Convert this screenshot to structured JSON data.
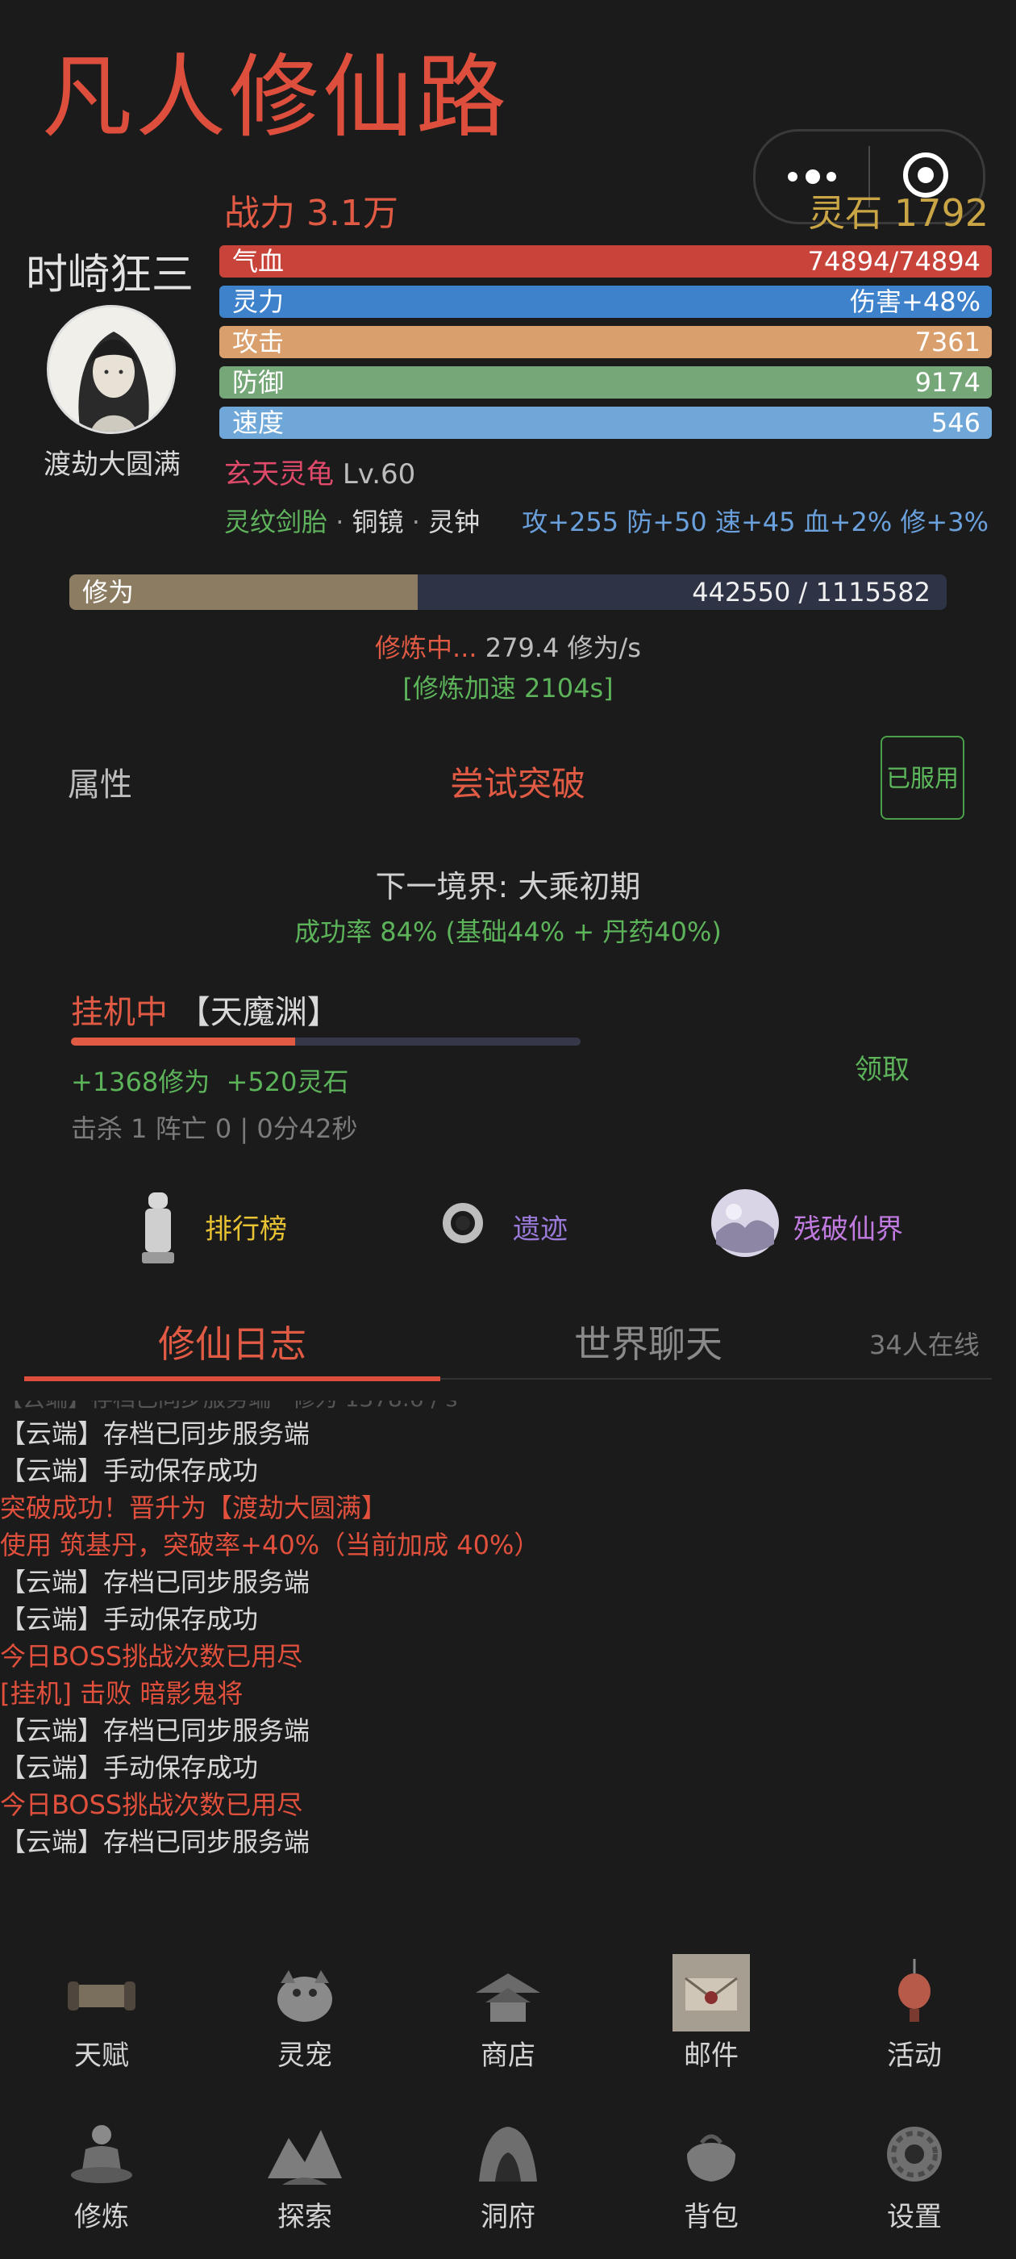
{
  "app": {
    "title": "凡人修仙路"
  },
  "header": {
    "power_label": "战力 3.1万",
    "stones_label": "灵石 1792"
  },
  "player": {
    "name": "时崎狂三",
    "realm": "渡劫大圆满"
  },
  "stats": [
    {
      "label": "气血",
      "value": "74894/74894",
      "color": "#c8443b"
    },
    {
      "label": "灵力",
      "value": "伤害+48%",
      "color": "#3e82cc"
    },
    {
      "label": "攻击",
      "value": "7361",
      "color": "#d9a06e"
    },
    {
      "label": "防御",
      "value": "9174",
      "color": "#76a779"
    },
    {
      "label": "速度",
      "value": "546",
      "color": "#6fa7d8"
    }
  ],
  "pet": {
    "name": "玄天灵龟",
    "level": "Lv.60"
  },
  "equipment": {
    "item1": "灵纹剑胎",
    "sep": "·",
    "item2": "铜镜",
    "item3": "灵钟",
    "bonus": "攻+255 防+50 速+45 血+2% 修+3%"
  },
  "cultivation": {
    "label": "修为",
    "current": 442550,
    "max": 1115582,
    "text": "442550 / 1115582",
    "status_prefix": "修炼中...",
    "status_rate": " 279.4 修为/s",
    "boost": "[修炼加速 2104s]"
  },
  "breakthrough": {
    "attr_label": "属性",
    "button": "尝试突破",
    "used_badge": "已服用",
    "next_realm": "下一境界: 大乘初期",
    "success_rate": "成功率 84% (基础44% + 丹药40%)"
  },
  "idle": {
    "status": "挂机中",
    "location": "【天魔渊】",
    "progress": 0.44,
    "gain_xp": "+1368修为",
    "gain_stones": "+520灵石",
    "claim": "领取",
    "stats": "击杀 1  阵亡 0 | 0分42秒"
  },
  "quick_links": [
    {
      "label": "排行榜",
      "color": "#e7c233",
      "icon": "statue-icon"
    },
    {
      "label": "遗迹",
      "color": "#9a7ad8",
      "icon": "ring-icon"
    },
    {
      "label": "残破仙界",
      "color": "#c07ae0",
      "icon": "cloud-orb-icon"
    }
  ],
  "tabs": {
    "log": "修仙日志",
    "chat": "世界聊天",
    "online": "34人在线"
  },
  "log_entries": [
    {
      "text": "【云端】存档已同步服务端",
      "color": "#d8d8d8"
    },
    {
      "text": "【云端】手动保存成功",
      "color": "#d8d8d8"
    },
    {
      "text": "突破成功！晋升为【渡劫大圆满】",
      "color": "#e0503c"
    },
    {
      "text": "使用 筑基丹，突破率+40%（当前加成 40%）",
      "color": "#e0503c"
    },
    {
      "text": "【云端】存档已同步服务端",
      "color": "#d8d8d8"
    },
    {
      "text": "【云端】手动保存成功",
      "color": "#d8d8d8"
    },
    {
      "text": "今日BOSS挑战次数已用尽",
      "color": "#e0503c"
    },
    {
      "text": "[挂机] 击败 暗影鬼将",
      "color": "#e0503c"
    },
    {
      "text": "【云端】存档已同步服务端",
      "color": "#d8d8d8"
    },
    {
      "text": "【云端】手动保存成功",
      "color": "#d8d8d8"
    },
    {
      "text": "今日BOSS挑战次数已用尽",
      "color": "#e0503c"
    },
    {
      "text": "【云端】存档已同步服务端",
      "color": "#d8d8d8"
    }
  ],
  "nav_row1": [
    {
      "label": "天赋",
      "icon": "scroll-icon"
    },
    {
      "label": "灵宠",
      "icon": "beast-icon"
    },
    {
      "label": "商店",
      "icon": "pavilion-icon"
    },
    {
      "label": "邮件",
      "icon": "letter-icon"
    },
    {
      "label": "活动",
      "icon": "lantern-icon"
    }
  ],
  "nav_row2": [
    {
      "label": "修炼",
      "icon": "meditation-icon"
    },
    {
      "label": "探索",
      "icon": "mountain-icon"
    },
    {
      "label": "洞府",
      "icon": "cave-icon"
    },
    {
      "label": "背包",
      "icon": "bag-icon"
    },
    {
      "label": "设置",
      "icon": "gear-icon"
    }
  ]
}
